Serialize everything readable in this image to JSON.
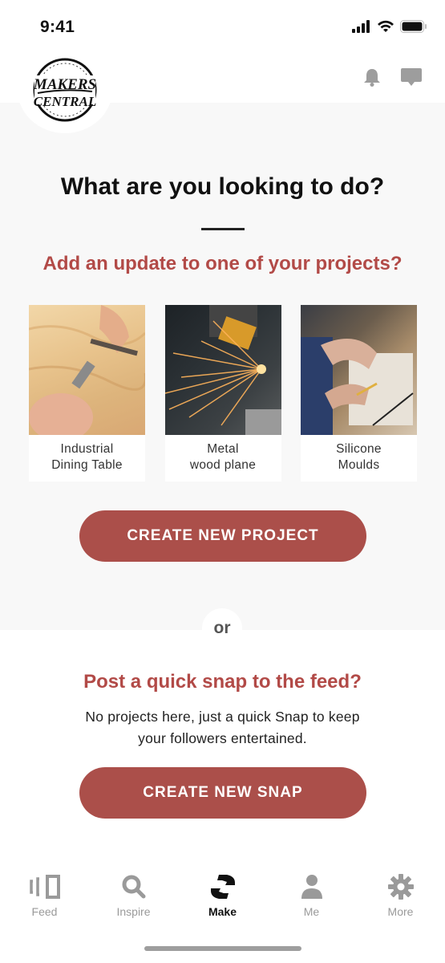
{
  "status_bar": {
    "time": "9:41"
  },
  "header": {
    "logo_top": "MAKERS",
    "logo_bottom": "CENTRAL",
    "icons": [
      "bell-icon",
      "chat-icon"
    ]
  },
  "main": {
    "title": "What are you looking to do?",
    "update_prompt": "Add an update to one of your projects?",
    "projects": [
      {
        "name": "Industrial\nDining Table",
        "image": "wood-carving-photo"
      },
      {
        "name": "Metal\nwood plane",
        "image": "grinding-sparks-photo"
      },
      {
        "name": "Silicone\nMoulds",
        "image": "workbench-drawing-photo"
      }
    ],
    "create_project_label": "CREATE NEW PROJECT",
    "or_label": "or",
    "snap_prompt": "Post a quick snap to the feed?",
    "snap_description": "No projects here, just a quick Snap to keep\nyour followers entertained.",
    "create_snap_label": "CREATE NEW SNAP"
  },
  "tab_bar": {
    "active": "Make",
    "tabs": [
      {
        "label": "Feed",
        "icon": "feed-icon"
      },
      {
        "label": "Inspire",
        "icon": "search-icon"
      },
      {
        "label": "Make",
        "icon": "make-hands-icon"
      },
      {
        "label": "Me",
        "icon": "person-icon"
      },
      {
        "label": "More",
        "icon": "gear-icon"
      }
    ]
  },
  "colors": {
    "accent": "#ab4f4a",
    "accent_text": "#b24a47",
    "section_bg": "#f8f8f8",
    "inactive_tab": "#9a9a9a"
  }
}
